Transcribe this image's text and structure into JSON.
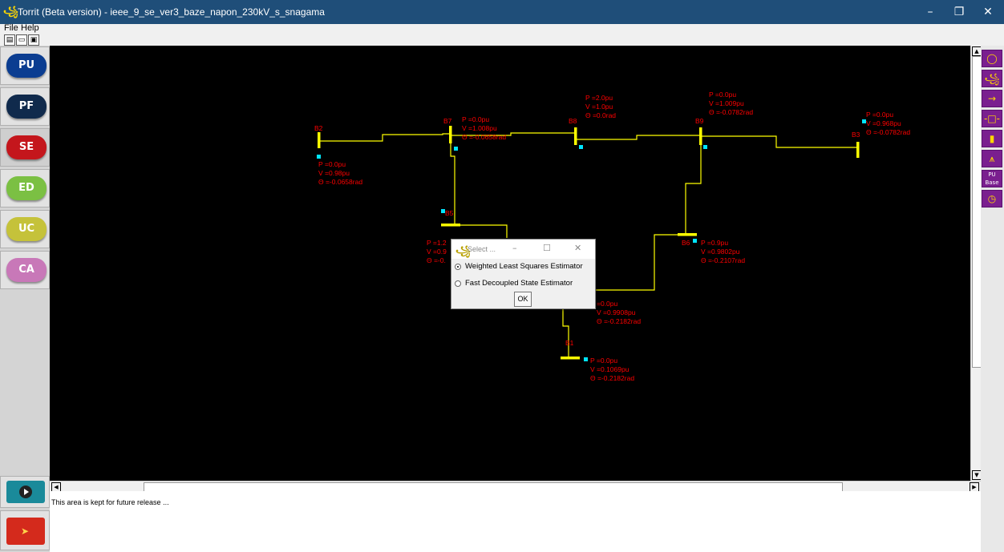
{
  "window": {
    "title": "Torrit (Beta version) - ieee_9_se_ver3_baze_napon_230kV_s_snagama",
    "app_icon": "torrit-logo-icon",
    "controls": [
      "minimize-icon",
      "restore-icon",
      "close-icon"
    ]
  },
  "menu": {
    "file": "File",
    "help": "Help"
  },
  "toolbar": {
    "icons": [
      "new-file-icon",
      "open-folder-icon",
      "save-icon"
    ]
  },
  "sidebar": {
    "buttons": [
      {
        "label": "PU",
        "color": "#0b3d91"
      },
      {
        "label": "PF",
        "color": "#102a4c"
      },
      {
        "label": "SE",
        "color": "#c4161c"
      },
      {
        "label": "ED",
        "color": "#7bc043"
      },
      {
        "label": "UC",
        "color": "#c5c23a"
      },
      {
        "label": "CA",
        "color": "#c878b8"
      }
    ],
    "run_icon": "play-icon",
    "clear_icon": "broom-icon"
  },
  "right_palette": {
    "icons": [
      "generator-icon",
      "transformer-icon",
      "load-arrow-icon",
      "line-icon",
      "bus-icon",
      "tower-icon",
      "pu-base-icon",
      "meter-icon"
    ],
    "pu_base_label_1": "PU",
    "pu_base_label_2": "Base"
  },
  "buses": {
    "B2": {
      "name": "B2",
      "p": "P =0.0pu",
      "v": "V =0.98pu",
      "theta": "Θ =-0.0658rad"
    },
    "B7": {
      "name": "B7",
      "p": "P =0.0pu",
      "v": "V =1.008pu",
      "theta": "Θ =-0.0658rad"
    },
    "B8": {
      "name": "B8",
      "p": "P =2.0pu",
      "v": "V =1.0pu",
      "theta": "Θ =0.0rad"
    },
    "B9": {
      "name": "B9",
      "p": "P =0.0pu",
      "v": "V =1.009pu",
      "theta": "Θ =-0.0782rad"
    },
    "B3": {
      "name": "B3",
      "p": "P =0.0pu",
      "v": "V =0.968pu",
      "theta": "Θ =-0.0782rad"
    },
    "B5": {
      "name": "B5",
      "p": "P =1.2",
      "v": "V =0.9",
      "theta": "Θ =-0."
    },
    "B6": {
      "name": "B6",
      "p": "P =0.9pu",
      "v": "V =0.9802pu",
      "theta": "Θ =-0.2107rad"
    },
    "B4": {
      "p": "=0.0pu",
      "v": "V =0.9908pu",
      "theta": "Θ =-0.2182rad"
    },
    "B1": {
      "name": "B1",
      "p": "P =0.0pu",
      "v": "V =0.1069pu",
      "theta": "Θ =-0.2182rad"
    }
  },
  "dialog": {
    "title": "Select ...",
    "options": [
      {
        "label": "Weighted Least Squares Estimator",
        "selected": true
      },
      {
        "label": "Fast Decoupled State Estimator",
        "selected": false
      }
    ],
    "ok": "OK"
  },
  "status": {
    "message": "This area is kept for future release ..."
  },
  "colors": {
    "canvas_bg": "#000000",
    "line": "#ffff00",
    "label": "#ff0000",
    "marker": "#00e5ff",
    "titlebar": "#1f4e79"
  }
}
